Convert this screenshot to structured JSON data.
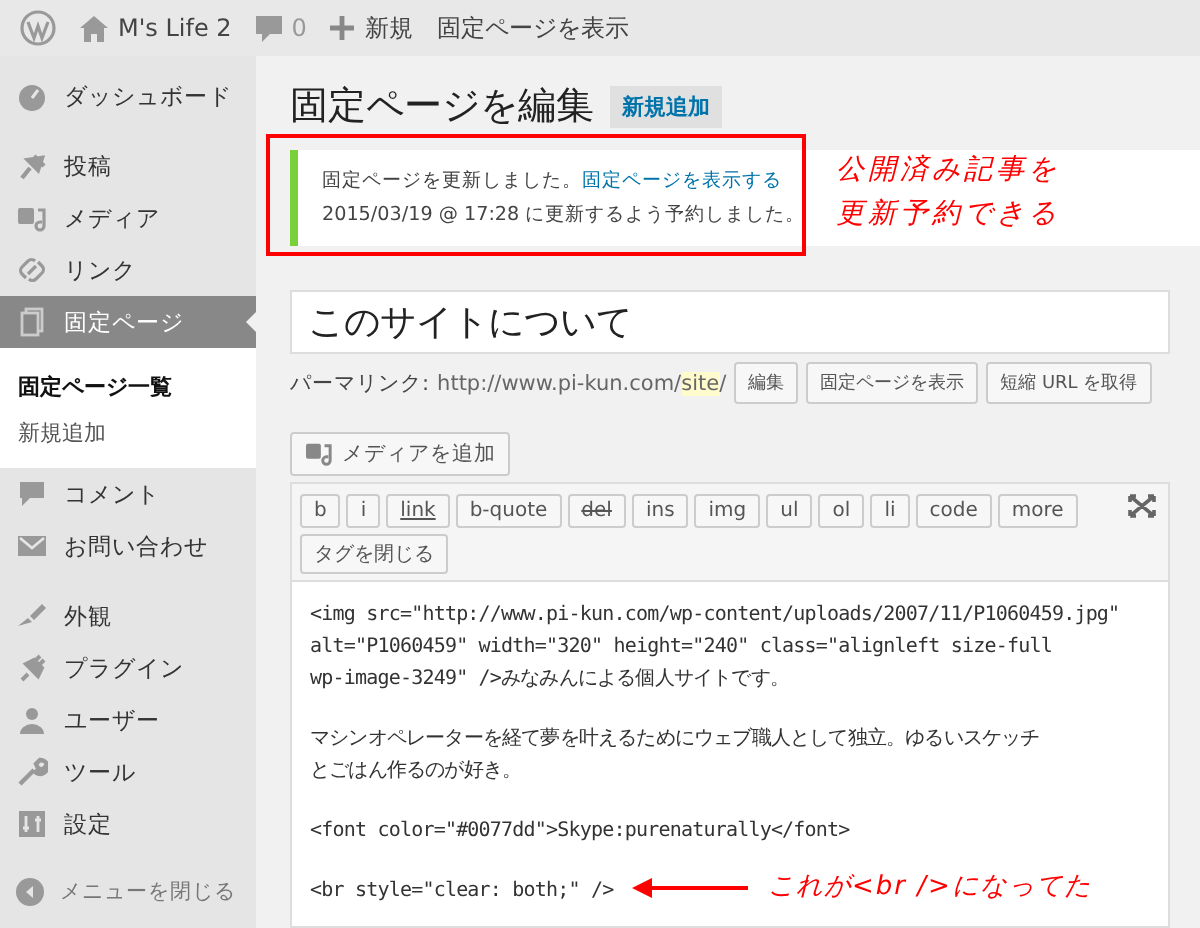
{
  "admin_bar": {
    "site_name": "M's Life 2",
    "comment_count": "0",
    "new_label": "新規",
    "view_label": "固定ページを表示"
  },
  "sidebar": {
    "groups": [
      [
        {
          "label": "ダッシュボード",
          "selected": false
        }
      ],
      [
        {
          "label": "投稿",
          "selected": false
        },
        {
          "label": "メディア",
          "selected": false
        },
        {
          "label": "リンク",
          "selected": false
        },
        {
          "label": "固定ページ",
          "selected": true,
          "children": [
            {
              "label": "固定ページ一覧",
              "selected": true
            },
            {
              "label": "新規追加",
              "selected": false
            }
          ]
        },
        {
          "label": "コメント",
          "selected": false
        },
        {
          "label": "お問い合わせ",
          "selected": false
        }
      ],
      [
        {
          "label": "外観",
          "selected": false
        },
        {
          "label": "プラグイン",
          "selected": false
        },
        {
          "label": "ユーザー",
          "selected": false
        },
        {
          "label": "ツール",
          "selected": false
        },
        {
          "label": "設定",
          "selected": false
        }
      ]
    ],
    "collapse_label": "メニューを閉じる"
  },
  "main": {
    "title": "固定ページを編集",
    "add_new": "新規追加",
    "notice": {
      "text": "固定ページを更新しました。",
      "link": "固定ページを表示する",
      "line2": "2015/03/19 @ 17:28 に更新するよう予約しました。"
    },
    "post_title": "このサイトについて",
    "permalink": {
      "label": "パーマリンク:",
      "base": "http://www.pi-kun.com/",
      "slug": "site",
      "suffix": "/",
      "buttons": [
        "編集",
        "固定ページを表示",
        "短縮 URL を取得"
      ]
    },
    "media_button": "メディアを追加",
    "quicktags": [
      {
        "label": "b",
        "kind": "plain"
      },
      {
        "label": "i",
        "kind": "plain"
      },
      {
        "label": "link",
        "kind": "link"
      },
      {
        "label": "b-quote",
        "kind": "plain"
      },
      {
        "label": "del",
        "kind": "del"
      },
      {
        "label": "ins",
        "kind": "plain"
      },
      {
        "label": "img",
        "kind": "plain"
      },
      {
        "label": "ul",
        "kind": "plain"
      },
      {
        "label": "ol",
        "kind": "plain"
      },
      {
        "label": "li",
        "kind": "plain"
      },
      {
        "label": "code",
        "kind": "plain"
      },
      {
        "label": "more",
        "kind": "plain"
      },
      {
        "label": "タグを閉じる",
        "kind": "plain"
      }
    ],
    "content": [
      [
        "<img src=\"http://www.pi-kun.com/wp-content/uploads/2007/11/P1060459.jpg\"",
        "alt=\"P1060459\" width=\"320\" height=\"240\" class=\"alignleft size-full",
        "wp-image-3249\" />みなみんによる個人サイトです。"
      ],
      [
        "マシンオペレーターを経て夢を叶えるためにウェブ職人として独立。ゆるいスケッチ",
        "とごはん作るのが好き。"
      ],
      [
        "<font color=\"#0077dd\">Skype:purenaturally</font>"
      ],
      [
        "<br style=\"clear: both;\" />"
      ]
    ]
  },
  "annotations": {
    "notice_note": [
      "公開済み記事を",
      "更新予約できる"
    ],
    "br_note": "これが<br />になってた"
  }
}
